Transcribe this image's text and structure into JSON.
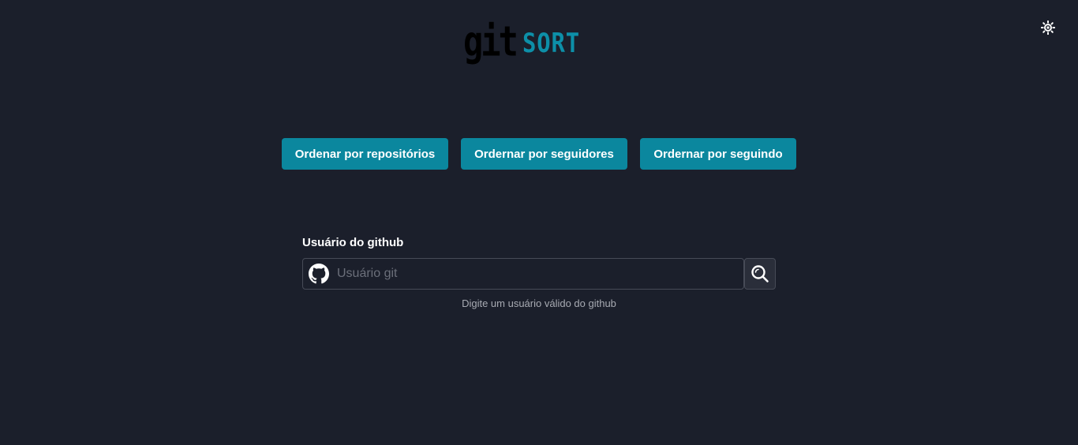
{
  "header": {
    "logo_text_git": "git",
    "logo_text_sort": "SORT",
    "theme_toggle_icon": "sun-icon"
  },
  "sort_buttons": [
    {
      "label": "Ordenar por repositórios"
    },
    {
      "label": "Ordernar por seguidores"
    },
    {
      "label": "Ordernar por seguindo"
    }
  ],
  "search": {
    "label": "Usuário do github",
    "placeholder": "Usuário git",
    "value": "",
    "helper": "Digite um usuário válido do github",
    "input_icon": "github-icon",
    "button_icon": "search-icon"
  },
  "colors": {
    "background": "#1b1f2b",
    "accent": "#0b879e",
    "logo_sort": "#0d8fa8"
  }
}
